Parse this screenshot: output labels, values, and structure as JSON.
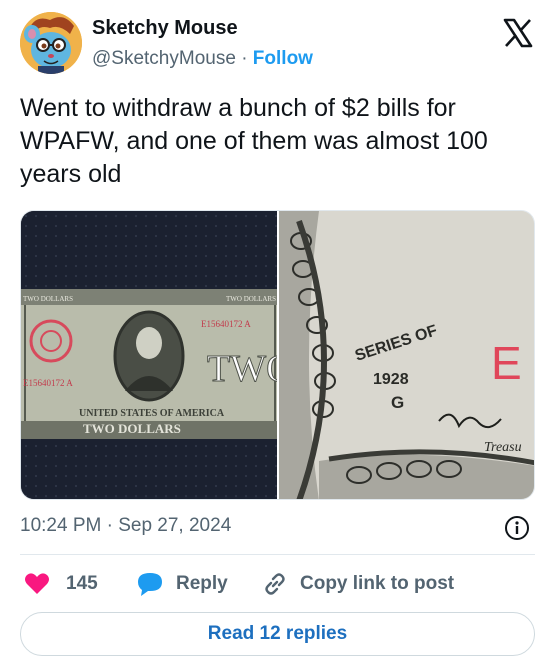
{
  "author": {
    "display_name": "Sketchy Mouse",
    "handle": "@SketchyMouse",
    "separator": "·",
    "follow_label": "Follow"
  },
  "platform_icon": "x-logo-icon",
  "tweet": {
    "text": "Went to withdraw a bunch of $2 bills for WPAFW, and one of them was almost 100 years old"
  },
  "media": {
    "left": {
      "denomination_top_left": "TWO DOLLARS",
      "denomination_top_right": "TWO DOLLARS",
      "serial_1": "E15640172 A",
      "serial_2": "E15640172 A",
      "word": "TWO",
      "banner": "UNITED STATES OF AMERICA",
      "bottom": "TWO DOLLARS"
    },
    "right": {
      "series_label": "SERIES OF",
      "year": "1928",
      "letter": "G",
      "seal_letter": "E",
      "treasury": "Treasu"
    }
  },
  "timestamp": "10:24 PM · Sep 27, 2024",
  "actions": {
    "like_count": "145",
    "reply_label": "Reply",
    "copy_link_label": "Copy link to post"
  },
  "read_replies_label": "Read 12 replies",
  "colors": {
    "like": "#f91880",
    "reply": "#1d9bf0",
    "follow": "#1d9bf0",
    "read_replies": "#1d6fbf"
  }
}
